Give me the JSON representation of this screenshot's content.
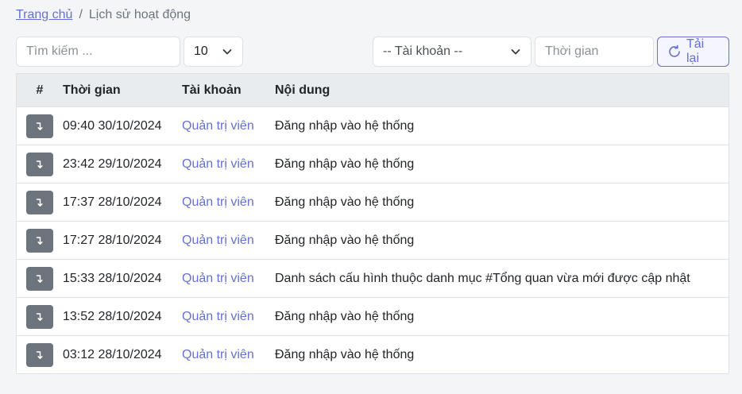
{
  "breadcrumb": {
    "home": "Trang chủ",
    "separator": "/",
    "current": "Lịch sử hoạt động"
  },
  "toolbar": {
    "search_placeholder": "Tìm kiếm ...",
    "page_size": "10",
    "account_select": "-- Tài khoản --",
    "time_placeholder": "Thời gian",
    "reload_label": "Tải lại"
  },
  "table": {
    "headers": [
      "#",
      "Thời gian",
      "Tài khoản",
      "Nội dung"
    ],
    "rows": [
      {
        "time": "09:40 30/10/2024",
        "account": "Quản trị viên",
        "content": "Đăng nhập vào hệ thống"
      },
      {
        "time": "23:42 29/10/2024",
        "account": "Quản trị viên",
        "content": "Đăng nhập vào hệ thống"
      },
      {
        "time": "17:37 28/10/2024",
        "account": "Quản trị viên",
        "content": "Đăng nhập vào hệ thống"
      },
      {
        "time": "17:27 28/10/2024",
        "account": "Quản trị viên",
        "content": "Đăng nhập vào hệ thống"
      },
      {
        "time": "15:33 28/10/2024",
        "account": "Quản trị viên",
        "content": "Danh sách cấu hình thuộc danh mục #Tổng quan vừa mới được cập nhật"
      },
      {
        "time": "13:52 28/10/2024",
        "account": "Quản trị viên",
        "content": "Đăng nhập vào hệ thống"
      },
      {
        "time": "03:12 28/10/2024",
        "account": "Quản trị viên",
        "content": "Đăng nhập vào hệ thống"
      }
    ]
  },
  "colors": {
    "accent": "#6670d4",
    "row_button": "#6c757d",
    "header_bg": "#e9ecef"
  },
  "icons": {
    "row_action": "arrow-turn-down-icon",
    "reload": "reload-icon",
    "dropdown": "chevron-down-icon"
  }
}
